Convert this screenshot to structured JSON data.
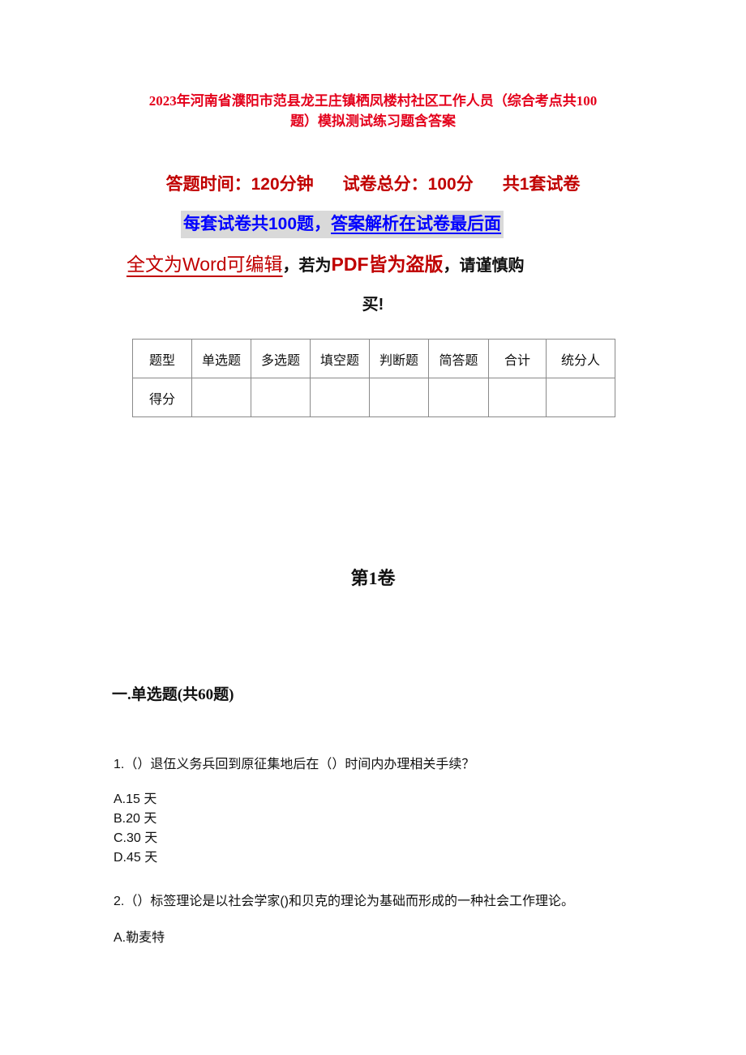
{
  "document": {
    "title_line1": "2023年河南省濮阳市范县龙王庄镇栖凤楼村社区工作人员（综合考点共100",
    "title_line2": "题）模拟测试练习题含答案",
    "meta": {
      "time": "答题时间：120分钟",
      "total_score": "试卷总分：100分",
      "sets": "共1套试卷"
    },
    "banner": {
      "part1": "每套试卷共100题，",
      "part2": "答案解析在试卷最后面"
    },
    "notice": {
      "part1": "全文为Word可编辑",
      "comma1": "，",
      "part2": "若为",
      "part3": "PDF皆为盗版",
      "comma2": "，",
      "part4": "请谨慎购",
      "line2": "买!"
    },
    "colors": {
      "title_red": "#e4001b",
      "meta_red": "#c00000",
      "banner_blue": "#0000ff",
      "banner_bg": "#d9d9d9"
    }
  },
  "score_table": {
    "headers": [
      "题型",
      "单选题",
      "多选题",
      "填空题",
      "判断题",
      "简答题",
      "合计",
      "统分人"
    ],
    "row_label": "得分",
    "row_values": [
      "",
      "",
      "",
      "",
      "",
      "",
      ""
    ]
  },
  "volume_title": "第1卷",
  "section_title": "一.单选题(共60题)",
  "questions": [
    {
      "text": "1.（）退伍义务兵回到原征集地后在（）时间内办理相关手续？",
      "options": [
        "A.15 天",
        "B.20 天",
        "C.30 天",
        "D.45 天"
      ]
    },
    {
      "text": "2.（）标签理论是以社会学家()和贝克的理论为基础而形成的一种社会工作理论。",
      "options": [
        "A.勒麦特"
      ]
    }
  ]
}
